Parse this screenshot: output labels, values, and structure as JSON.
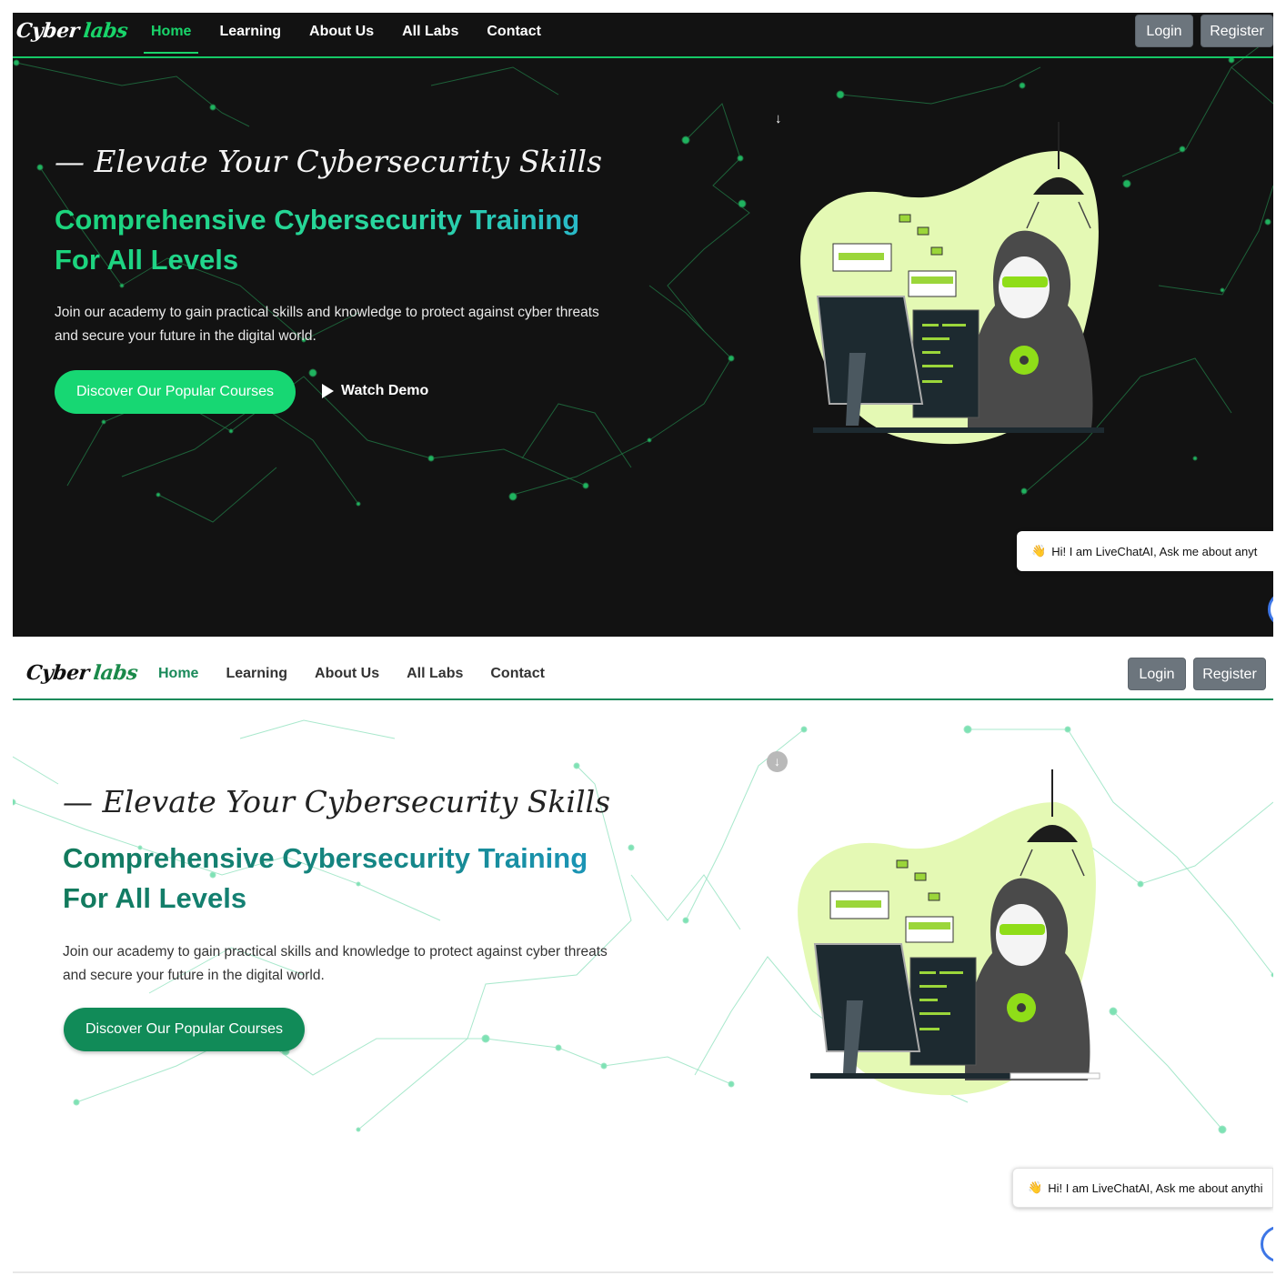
{
  "brand": {
    "word1": "Cyber",
    "word2": "labs"
  },
  "nav": {
    "items": [
      {
        "label": "Home",
        "active": true
      },
      {
        "label": "Learning",
        "active": false
      },
      {
        "label": "About Us",
        "active": false
      },
      {
        "label": "All Labs",
        "active": false
      },
      {
        "label": "Contact",
        "active": false
      }
    ],
    "login_label": "Login",
    "register_label": "Register"
  },
  "hero": {
    "tagline": "— Elevate Your Cybersecurity Skills",
    "headline_line1": "Comprehensive Cybersecurity Training",
    "headline_line2": "For All Levels",
    "description": "Join our academy to gain practical skills and knowledge to protect against cyber threats and secure your future in the digital world.",
    "cta_label": "Discover Our Popular Courses",
    "watch_demo_label": "Watch Demo"
  },
  "livechat": {
    "message_dark": "Hi! I am LiveChatAI, Ask me about anyt",
    "message_light": "Hi! I am LiveChatAI, Ask me about anythi"
  },
  "icons": {
    "scroll_down": "arrow-down-icon",
    "play": "play-icon",
    "wave": "waving-hand-icon",
    "chat": "chat-bubble-icon"
  },
  "colors": {
    "dark_bg": "#121212",
    "dark_accent": "#19d46a",
    "light_accent": "#1a8a5a",
    "headline_end": "#28a6e0",
    "illustration_blob": "#e4f9b4",
    "nav_button": "#6c757d"
  }
}
